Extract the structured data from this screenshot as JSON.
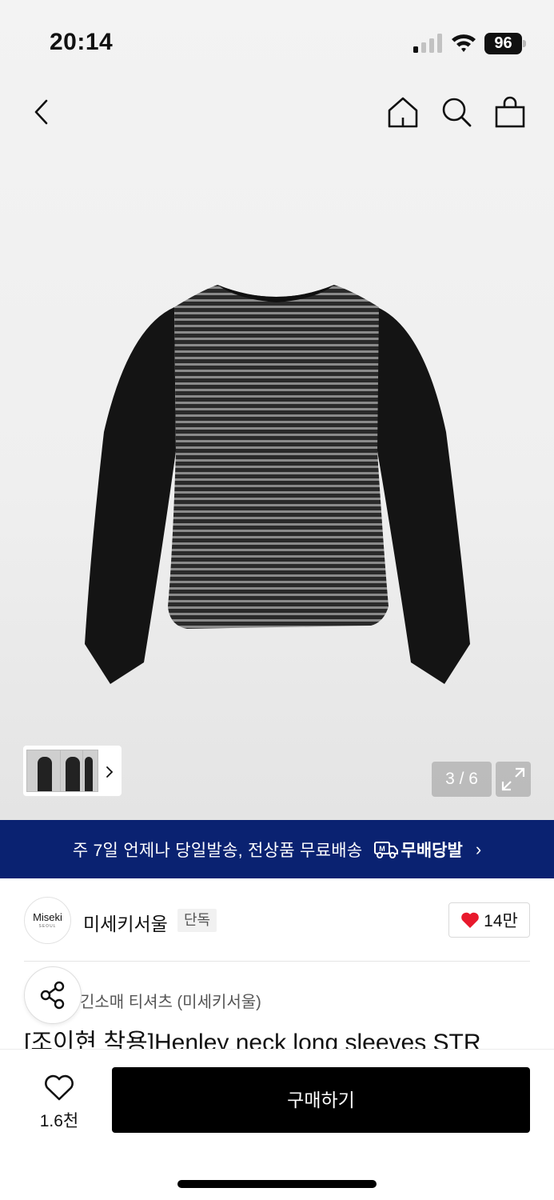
{
  "status_bar": {
    "time": "20:14",
    "battery": "96"
  },
  "colors": {
    "banner_bg": "#0a2271",
    "heart": "#e8192c",
    "buy_button": "#000000"
  },
  "nav": {
    "back_icon": "chevron-left-icon",
    "home_icon": "home-icon",
    "search_icon": "search-icon",
    "cart_icon": "shopping-bag-icon"
  },
  "gallery": {
    "counter": "3 / 6"
  },
  "banner": {
    "text": "주 7일 언제나 당일발송, 전상품 무료배송",
    "brand": "무배당발"
  },
  "brand": {
    "logo_text": "Miseki",
    "logo_sub": "SEOUL",
    "name": "미세키서울",
    "tag": "단독",
    "likes": "14만"
  },
  "product": {
    "category": "긴소매 티셔츠 (미세키서울)",
    "title": "[조이현 착용]Henley neck long sleeves STR"
  },
  "bottom": {
    "wish_count": "1.6천",
    "buy_label": "구매하기"
  }
}
